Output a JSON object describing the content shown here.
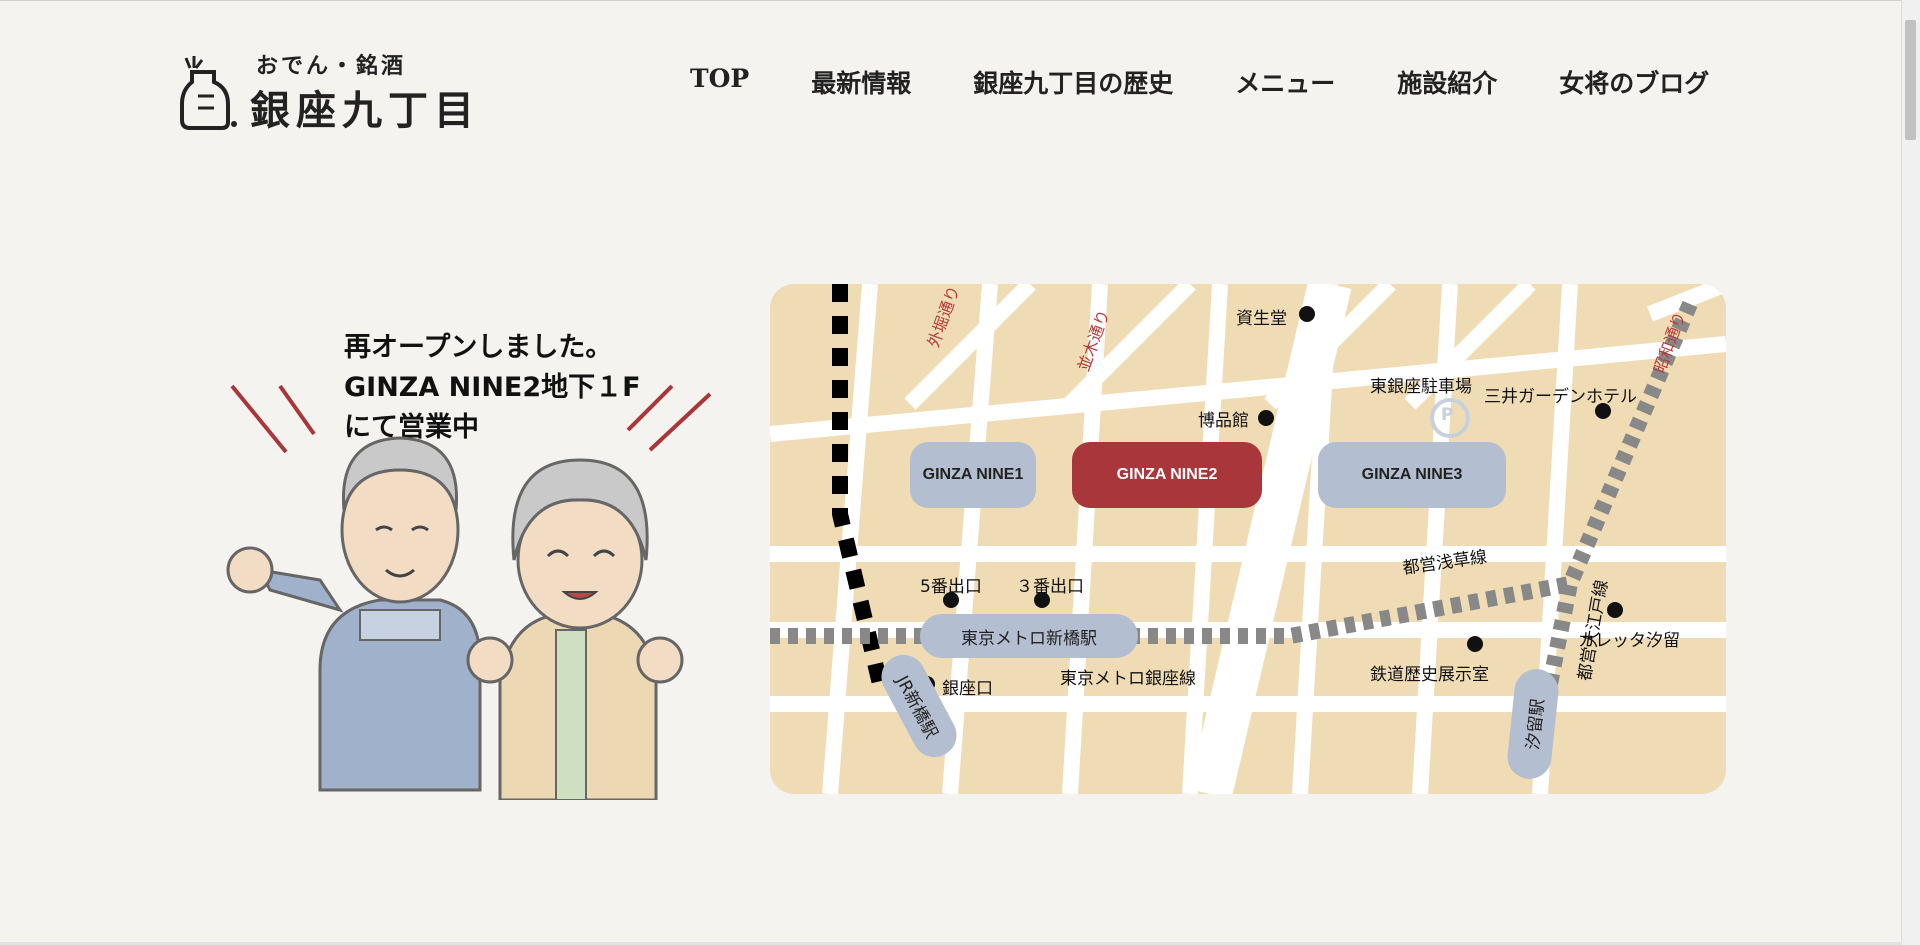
{
  "logo": {
    "tagline": "おでん・銘酒",
    "name": "銀座九丁目"
  },
  "nav": {
    "items": [
      {
        "label": "TOP"
      },
      {
        "label": "最新情報"
      },
      {
        "label": "銀座九丁目の歴史"
      },
      {
        "label": "メニュー"
      },
      {
        "label": "施設紹介"
      },
      {
        "label": "女将のブログ"
      }
    ]
  },
  "announcement": {
    "line1": "再オープンしました。",
    "line2": "GINZA NINE2地下１F",
    "line3": "にて営業中"
  },
  "map": {
    "buildings": {
      "nine1": "GINZA NINE1",
      "nine2": "GINZA NINE2",
      "nine3": "GINZA NINE3"
    },
    "streets": {
      "sotobori": "外堀通り",
      "namiki": "並木通り",
      "showa": "昭和通り"
    },
    "landmarks": {
      "shiseido": "資生堂",
      "hakuhinkan": "博品館",
      "higashi_parking": "東銀座駐車場",
      "mitsui_hotel": "三井ガーデンホテル",
      "exit5": "5番出口",
      "exit3": "３番出口",
      "ginzaguchi": "銀座口",
      "caretta": "カレッタ汐留",
      "railway_museum": "鉄道歴史展示室"
    },
    "lines": {
      "asakusa": "都営浅草線",
      "ginza_line": "東京メトロ銀座線",
      "oedo": "都営大江戸線"
    },
    "stations": {
      "metro_shimbashi": "東京メトロ新橋駅",
      "jr_shimbashi": "JR新橋駅",
      "shiodome": "汐留駅"
    },
    "parking_icon": "P",
    "colors": {
      "land": "#f0dcb4",
      "road": "#ffffff",
      "active_building": "#a8363a",
      "building": "#b3bfd0"
    }
  }
}
